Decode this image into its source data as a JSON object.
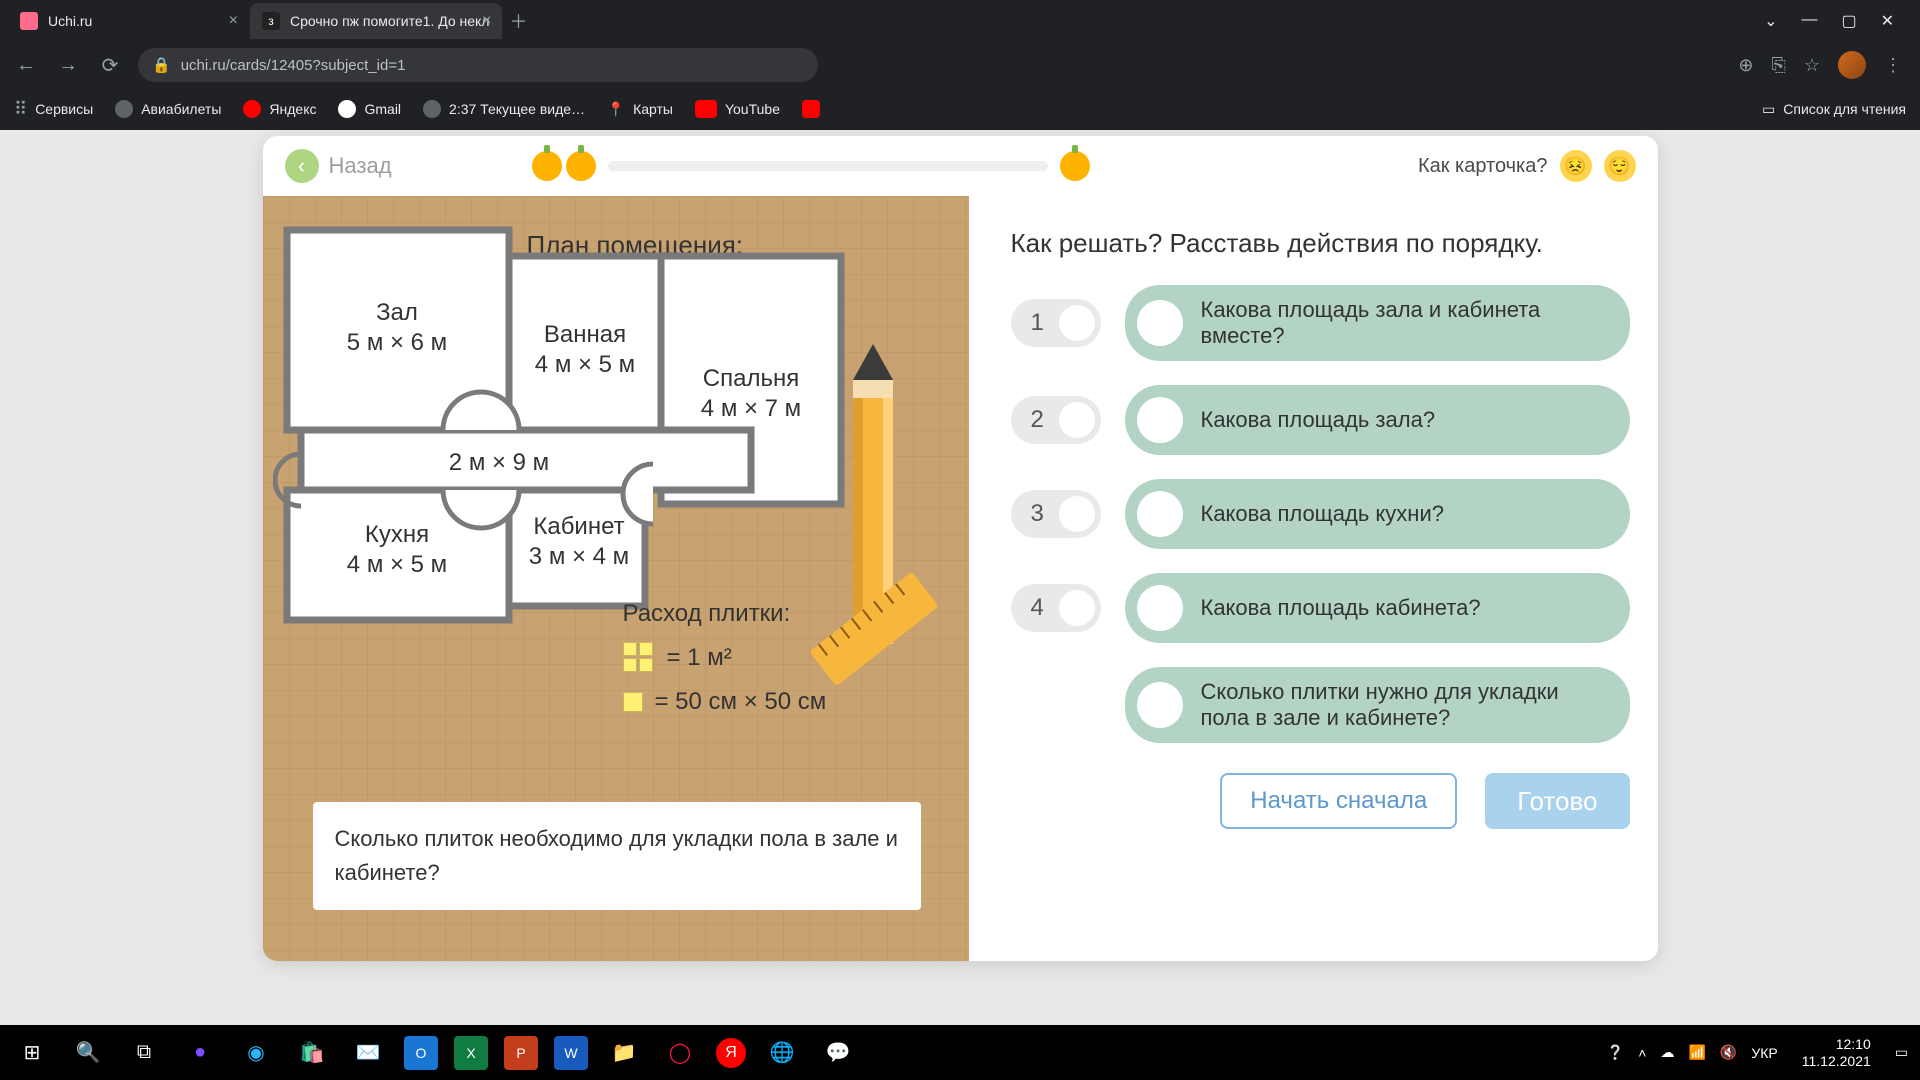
{
  "browser": {
    "tabs": [
      {
        "title": "Uchi.ru"
      },
      {
        "title": "Срочно пж помогите1. До некл"
      }
    ],
    "url": "uchi.ru/cards/12405?subject_id=1",
    "bookmarks": {
      "services": "Сервисы",
      "avia": "Авиабилеты",
      "yandex": "Яндекс",
      "gmail": "Gmail",
      "video": "2:37 Текущее виде…",
      "maps": "Карты",
      "youtube": "YouTube",
      "reading": "Список для чтения"
    }
  },
  "card": {
    "back": "Назад",
    "rate_label": "Как карточка?",
    "plan_title": "План помещения:",
    "rooms": {
      "hall": {
        "name": "Зал",
        "dims": "5 м  ×  6 м"
      },
      "bath": {
        "name": "Ванная",
        "dims": "4 м  ×  5 м"
      },
      "bed": {
        "name": "Спальня",
        "dims": "4 м  ×  7 м"
      },
      "hallwy": {
        "dims": "2 м  ×  9 м"
      },
      "kitch": {
        "name": "Кухня",
        "dims": "4 м  ×  5 м"
      },
      "study": {
        "name": "Кабинет",
        "dims": "3 м  ×  4 м"
      }
    },
    "tile_usage_title": "Расход плитки:",
    "tile_1m": "=   1 м²",
    "tile_50": "=   50 см  ×   50 см",
    "question": "Сколько плиток необходимо для укладки пола в зале и кабинете?",
    "task_title": "Как решать? Расставь действия по порядку.",
    "numbers": [
      "1",
      "2",
      "3",
      "4"
    ],
    "options": [
      "Какова площадь зала и кабинета вместе?",
      "Какова площадь зала?",
      "Какова площадь кухни?",
      "Какова площадь кабинета?",
      "Сколько плитки нужно для укладки пола в зале и кабинете?"
    ],
    "btn_restart": "Начать сначала",
    "btn_done": "Готово"
  },
  "taskbar": {
    "lang": "УКР",
    "time": "12:10",
    "date": "11.12.2021"
  }
}
